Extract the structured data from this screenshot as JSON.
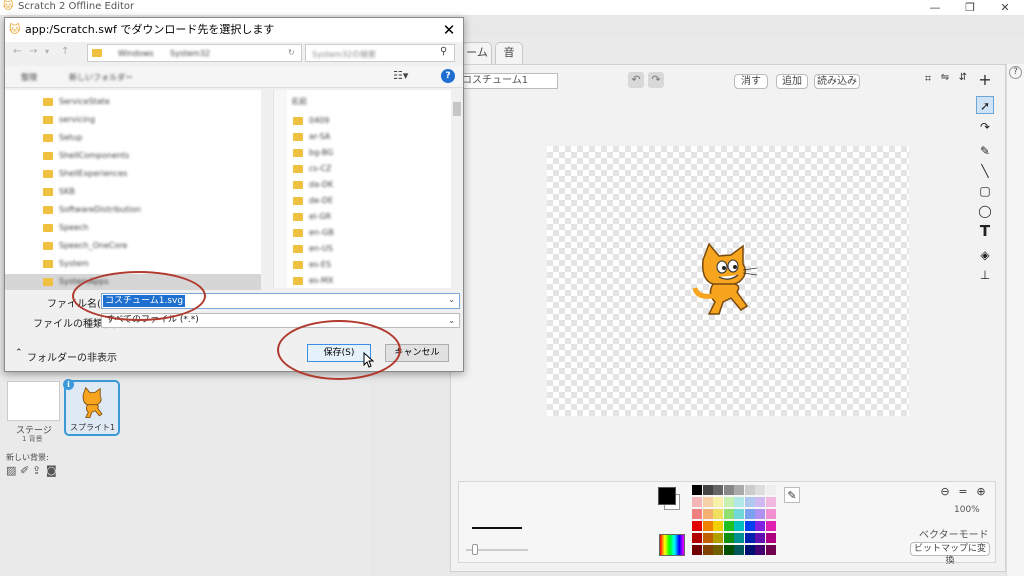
{
  "window": {
    "title": "Scratch 2 Offline Editor",
    "minimize": "—",
    "maximize": "❐",
    "close": "✕"
  },
  "editor": {
    "tabs": [
      "ーム",
      "音"
    ],
    "costume_name": "コスチューム1",
    "clear_label": "消す",
    "add_label": "追加",
    "import_label": "読み込み",
    "zoom_level": "100%",
    "mode_label": "ベクターモード",
    "convert_label": "ビットマップに変換"
  },
  "sprites": {
    "stage_label": "ステージ",
    "stage_sub": "1 背景",
    "new_backdrop_label": "新しい背景:",
    "sprite_label": "スプライト1"
  },
  "dialog": {
    "title": "app:/Scratch.swf でダウンロード先を選択します",
    "filename_label": "ファイル名(N):",
    "filename_value": "コスチューム1.svg",
    "filetype_label": "ファイルの種類(T):",
    "filetype_value": "すべてのファイル (*.*)",
    "hide_folders_label": "フォルダーの非表示",
    "save_label": "保存(S)",
    "cancel_label": "キャンセル",
    "address_blurred": [
      "Windows",
      "System32"
    ],
    "search_placeholder": "System32の検索",
    "cmd_items": [
      "整理",
      "新しいフォルダー"
    ],
    "folders": [
      "ServiceState",
      "servicing",
      "Setup",
      "ShellComponents",
      "ShellExperiences",
      "SKB",
      "SoftwareDistribution",
      "Speech",
      "Speech_OneCore",
      "System",
      "SystemApps"
    ],
    "files_header": "名前",
    "files": [
      "0409",
      "ar-SA",
      "bg-BG",
      "cs-CZ",
      "da-DK",
      "de-DE",
      "el-GR",
      "en-GB",
      "en-US",
      "es-ES",
      "es-MX"
    ]
  },
  "colors": {
    "accent": "#3a9ad9",
    "annotation": "#b03a2e",
    "selection": "#1e6fd0"
  }
}
